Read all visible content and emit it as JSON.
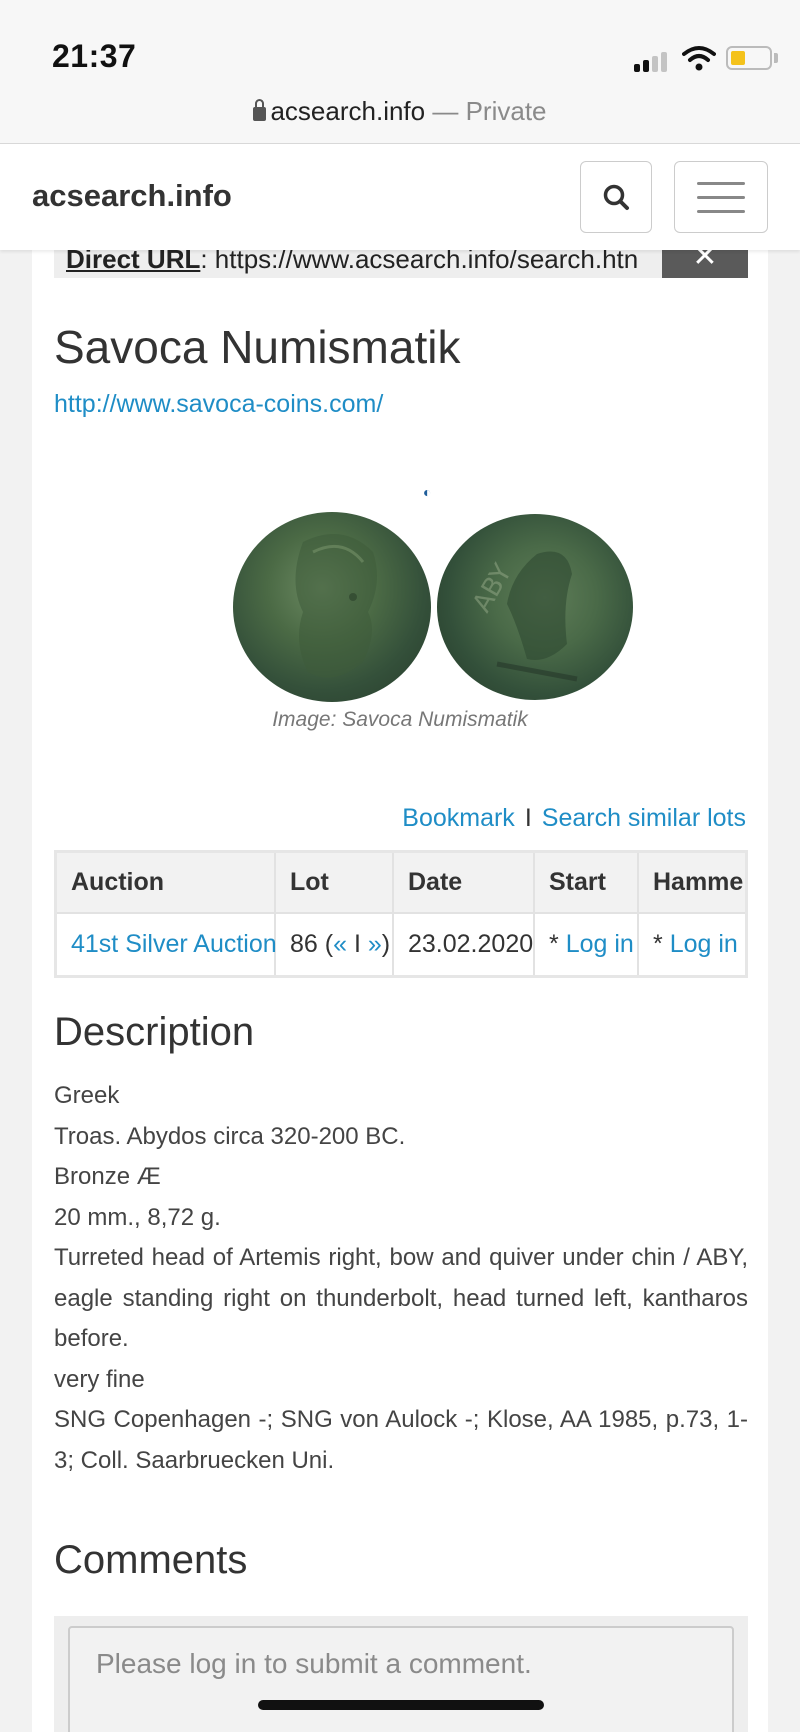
{
  "status_bar": {
    "time": "21:37",
    "icons": [
      "signal-icon",
      "wifi-icon",
      "battery-icon"
    ],
    "battery_color": "#f4c21b"
  },
  "browser": {
    "domain": "acsearch.info",
    "mode": "— Private"
  },
  "header": {
    "brand": "acsearch.info",
    "icons": [
      "search-icon",
      "menu-icon"
    ]
  },
  "direct_url": {
    "label": "Direct URL",
    "value": ": https://www.acsearch.info/search.htn",
    "close_label": "✕"
  },
  "auction_house": {
    "name": "Savoca Numismatik",
    "url": "http://www.savoca-coins.com/"
  },
  "image": {
    "caption": "Image: Savoca Numismatik"
  },
  "actions": {
    "bookmark": "Bookmark",
    "separator": "I",
    "search_similar": "Search similar lots"
  },
  "lot_table": {
    "headers": [
      "Auction",
      "Lot",
      "Date",
      "Start",
      "Hammer"
    ],
    "row": {
      "auction": "41st Silver Auction",
      "lot": "86",
      "lot_prev": "«",
      "lot_sep": "I",
      "lot_next": "»",
      "date": "23.02.2020",
      "start_prefix": "* ",
      "start_link": "Log in",
      "hammer_prefix": "* ",
      "hammer_link": "Log in"
    }
  },
  "description": {
    "title": "Description",
    "lines": [
      "Greek",
      "Troas. Abydos circa 320-200 BC.",
      "Bronze Æ",
      "20 mm., 8,72 g.",
      "Turreted head of Artemis right, bow and quiver under chin / ABY, eagle standing right on thunderbolt, head turned left, kantharos before.",
      "very fine",
      "SNG Copenhagen -; SNG von Aulock -; Klose, AA 1985, p.73, 1-3; Coll. Saarbruecken Uni."
    ]
  },
  "comments": {
    "title": "Comments",
    "placeholder": "Please log in to submit a comment."
  },
  "colors": {
    "link": "#1f8dc6",
    "text": "#333333",
    "background": "#f2f2f2"
  }
}
